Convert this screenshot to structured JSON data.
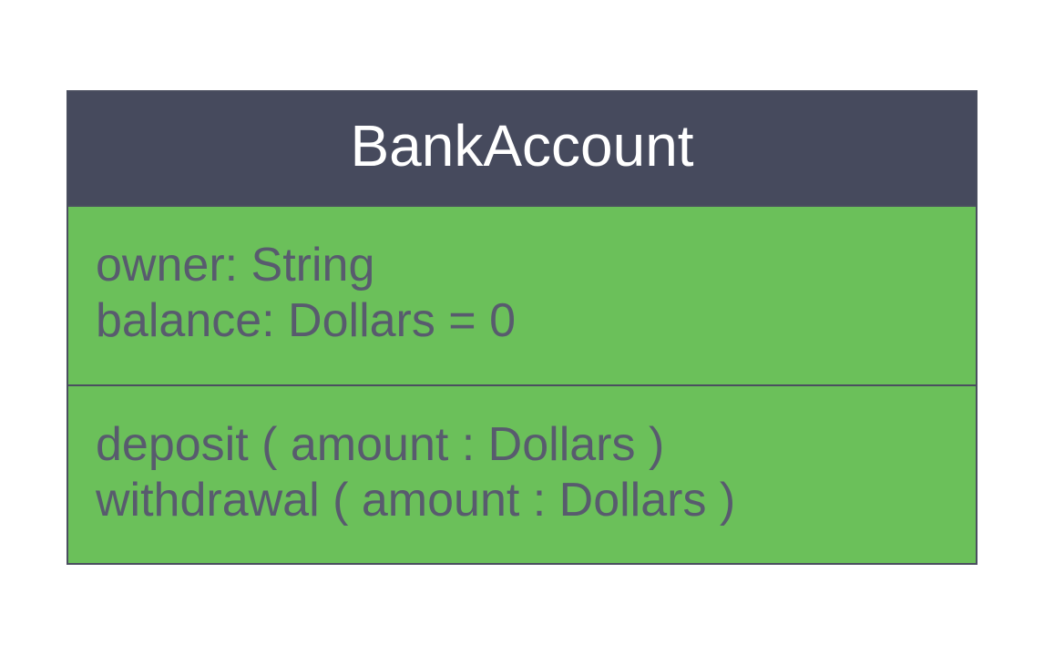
{
  "class": {
    "name": "BankAccount",
    "attributes": [
      "owner: String",
      "balance: Dollars = 0"
    ],
    "methods": [
      "deposit ( amount : Dollars )",
      "withdrawal ( amount : Dollars )"
    ]
  }
}
